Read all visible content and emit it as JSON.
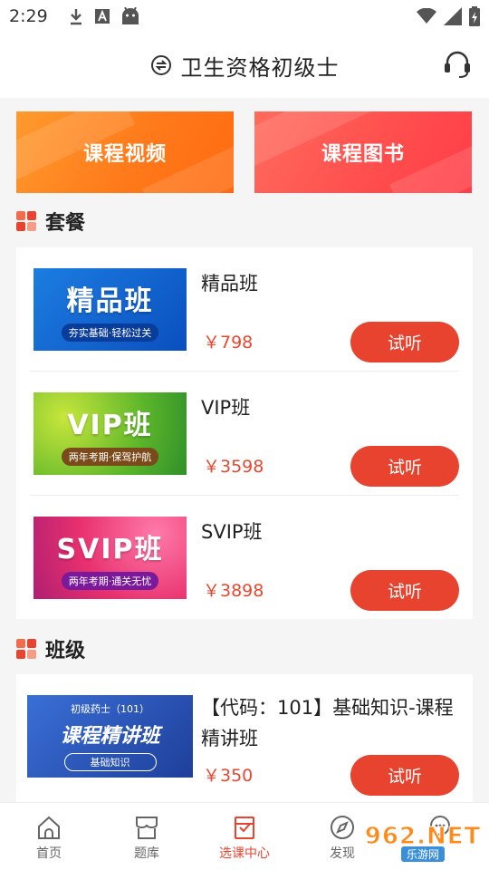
{
  "status_bar": {
    "time": "2:29"
  },
  "header": {
    "title": "卫生资格初级士"
  },
  "banners": [
    {
      "label": "课程视频",
      "color": "#ff8a20"
    },
    {
      "label": "课程图书",
      "color": "#ff4d4d"
    }
  ],
  "packages": {
    "title": "套餐",
    "items": [
      {
        "name": "精品班",
        "price": "￥798",
        "thumb_title": "精品班",
        "thumb_tag": "夯实基础·轻松过关",
        "button": "试听"
      },
      {
        "name": "VIP班",
        "price": "￥3598",
        "thumb_title": "VIP班",
        "thumb_tag": "两年考期·保驾护航",
        "button": "试听"
      },
      {
        "name": "SVIP班",
        "price": "￥3898",
        "thumb_title": "SVIP班",
        "thumb_tag": "两年考期·通关无忧",
        "button": "试听"
      }
    ]
  },
  "classes": {
    "title": "班级",
    "items": [
      {
        "name": "【代码：101】基础知识-课程精讲班",
        "price": "￥350",
        "thumb_top": "初级药士（101）",
        "thumb_title": "课程精讲班",
        "thumb_tag": "基础知识",
        "button": "试听"
      }
    ]
  },
  "tabbar": {
    "tabs": [
      {
        "label": "首页",
        "icon": "home-icon"
      },
      {
        "label": "题库",
        "icon": "question-bank-icon"
      },
      {
        "label": "选课中心",
        "icon": "course-center-icon",
        "active": true
      },
      {
        "label": "发现",
        "icon": "compass-icon"
      },
      {
        "label": "",
        "icon": "chat-icon"
      }
    ]
  },
  "watermark": {
    "line1": "962.NET",
    "line2": "乐游网"
  },
  "colors": {
    "accent": "#e8432f",
    "price": "#e8472f"
  }
}
